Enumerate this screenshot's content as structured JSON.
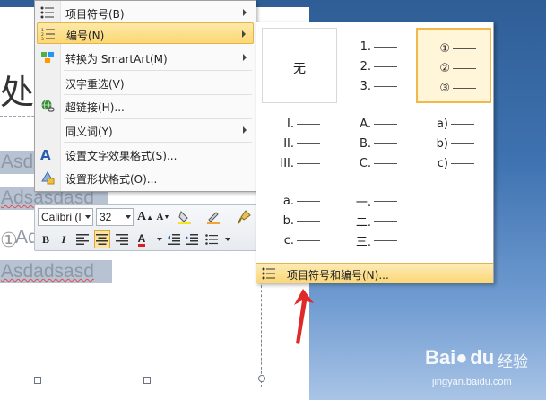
{
  "slide": {
    "title_fragment": "处汽",
    "body_lines": [
      "Asd",
      "Adsasdasd",
      "Ad",
      "Asdadsasd"
    ],
    "circle_fragment": "①"
  },
  "context_menu": {
    "items": [
      {
        "label": "项目符号(B)",
        "icon": "bullets-icon",
        "has_submenu": true
      },
      {
        "label": "编号(N)",
        "icon": "numbering-icon",
        "has_submenu": true,
        "highlighted": true
      },
      {
        "label": "转换为 SmartArt(M)",
        "icon": "smartart-icon",
        "has_submenu": true
      },
      {
        "label": "汉字重选(V)",
        "icon": "",
        "has_submenu": false
      },
      {
        "label": "超链接(H)...",
        "icon": "hyperlink-icon",
        "has_submenu": false
      },
      {
        "label": "同义词(Y)",
        "icon": "",
        "has_submenu": true
      },
      {
        "label": "设置文字效果格式(S)...",
        "icon": "text-effects-icon",
        "has_submenu": false
      },
      {
        "label": "设置形状格式(O)...",
        "icon": "shape-format-icon",
        "has_submenu": false
      }
    ]
  },
  "mini_toolbar": {
    "font_name": "Calibri (I",
    "font_size": "32",
    "grow_label": "A",
    "shrink_label": "A",
    "bold": "B",
    "italic": "I",
    "font_color_label": "A",
    "colors": {
      "highlight": "#f5e32a",
      "font": "#d42020"
    }
  },
  "numbering_gallery": {
    "none_label": "无",
    "styles": [
      [
        "1.",
        "2.",
        "3."
      ],
      [
        "①",
        "②",
        "③"
      ],
      [
        "I.",
        "II.",
        "III."
      ],
      [
        "A.",
        "B.",
        "C."
      ],
      [
        "a)",
        "b)",
        "c)"
      ],
      [
        "a.",
        "b.",
        "c."
      ],
      [
        "一.",
        "二.",
        "三."
      ]
    ],
    "selected_index": 1,
    "footer_label": "项目符号和编号(N)..."
  },
  "watermark": {
    "brand": "Bai",
    "brand_suffix": "du",
    "cn": "经验",
    "url": "jingyan.baidu.com"
  }
}
